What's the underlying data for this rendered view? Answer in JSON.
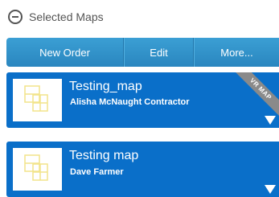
{
  "header": {
    "title": "Selected Maps",
    "icon": "collapse-circle-minus-icon"
  },
  "toolbar": {
    "new_order_label": "New Order",
    "edit_label": "Edit",
    "more_label": "More..."
  },
  "maps": [
    {
      "title": "Testing_map",
      "subtitle": "Alisha McNaught Contractor",
      "ribbon": "VR MAP"
    },
    {
      "title": "Testing map",
      "subtitle": "Dave Farmer"
    }
  ],
  "colors": {
    "toolbar": "#2a86bf",
    "card": "#0a6fc9",
    "ribbon": "#8a8a8a"
  }
}
